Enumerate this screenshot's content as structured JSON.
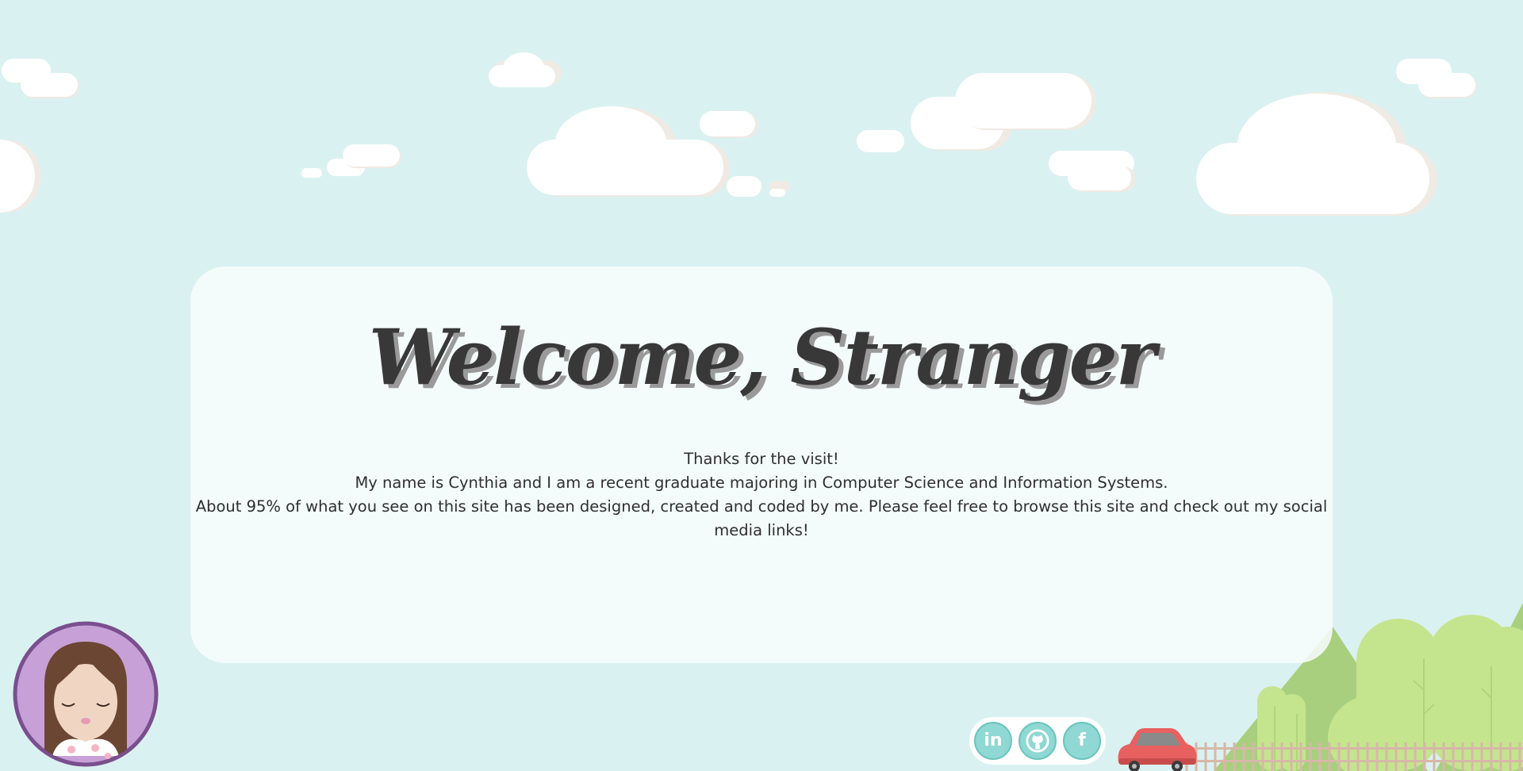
{
  "welcome": {
    "title": "Welcome, Stranger",
    "lines": [
      "Thanks for the visit!",
      "My name is Cynthia and I am a recent graduate majoring in Computer Science and Information Systems.",
      "About 95% of what you see on this site has been designed, created and coded by me. Please feel free to browse this site and check out my social media links!"
    ]
  },
  "social": [
    {
      "icon": "linkedin-icon",
      "glyph": "in"
    },
    {
      "icon": "github-icon",
      "glyph": ""
    },
    {
      "icon": "facebook-icon",
      "glyph": "f"
    }
  ],
  "colors": {
    "sky": "#daf1f1",
    "card": "#f7fcfc",
    "title": "#383838",
    "social_button": "#8fd8d3",
    "avatar_ring": "#c8a0d8",
    "tree_light": "#c5e48e",
    "tree_dark": "#a8cf7d",
    "car": "#e86060"
  }
}
